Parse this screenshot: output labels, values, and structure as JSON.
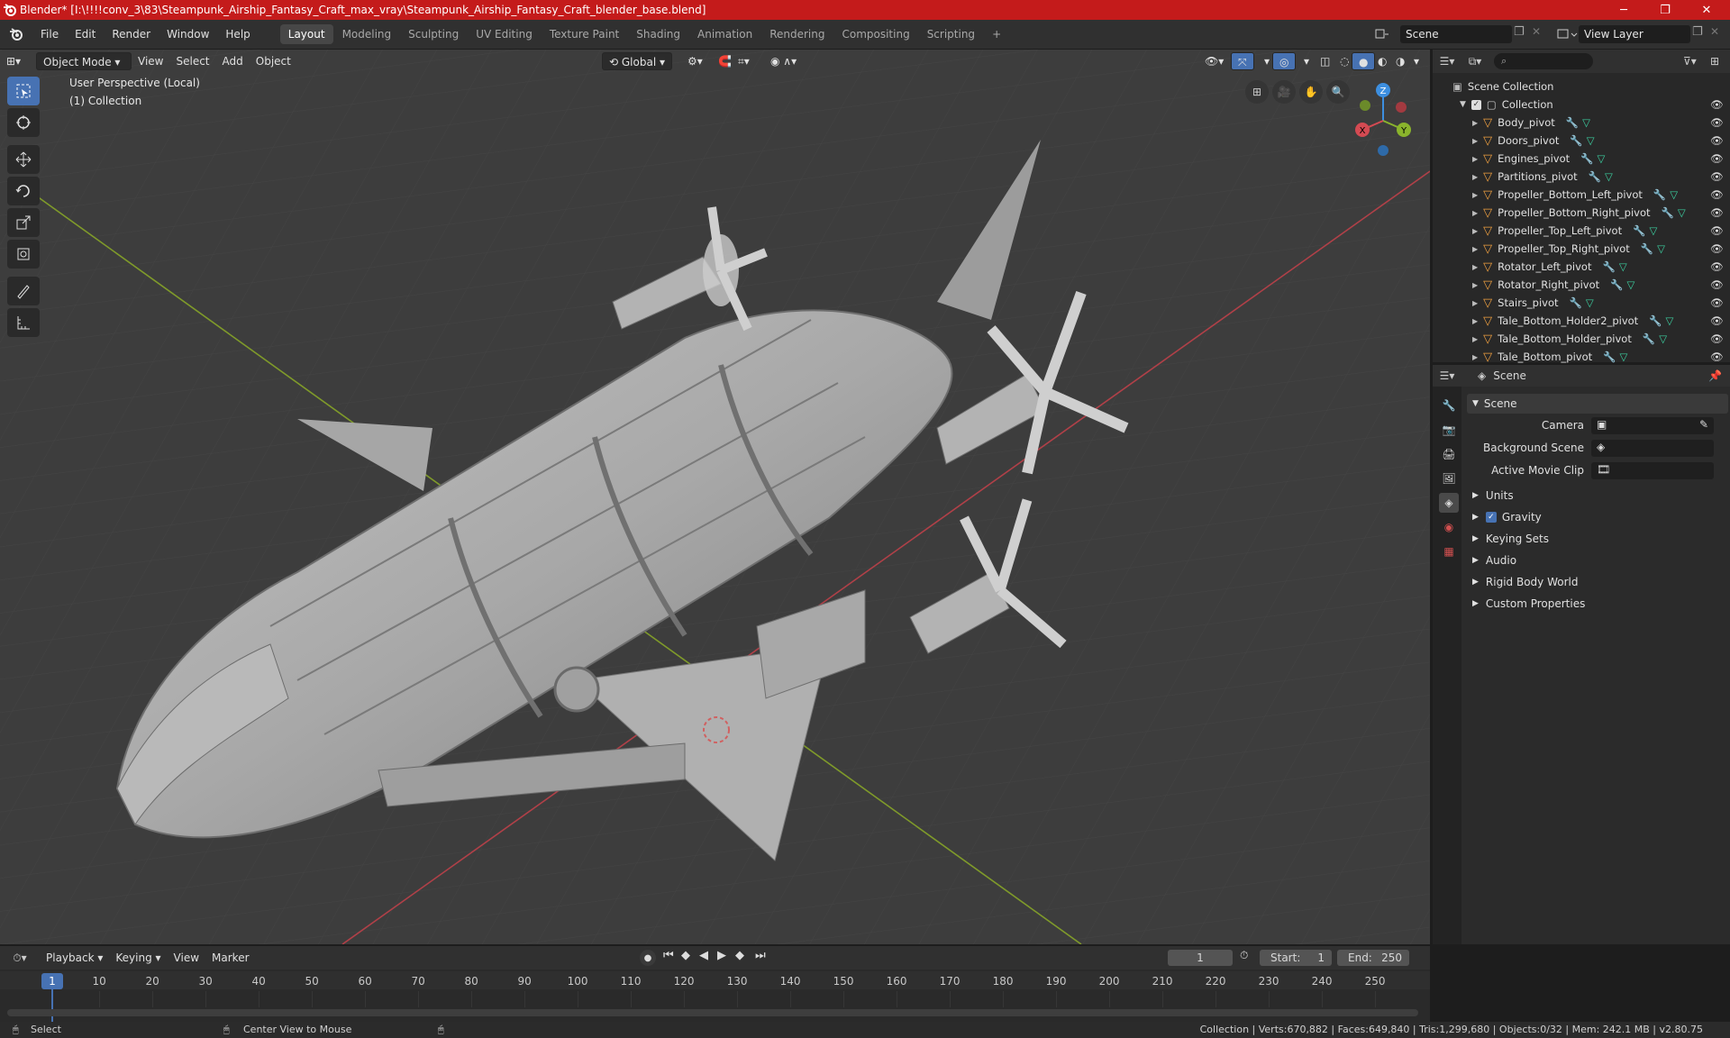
{
  "window": {
    "title": "Blender* [I:\\!!!!conv_3\\83\\Steampunk_Airship_Fantasy_Craft_max_vray\\Steampunk_Airship_Fantasy_Craft_blender_base.blend]"
  },
  "menu": {
    "file": "File",
    "edit": "Edit",
    "render": "Render",
    "window": "Window",
    "help": "Help"
  },
  "workspaces": [
    "Layout",
    "Modeling",
    "Sculpting",
    "UV Editing",
    "Texture Paint",
    "Shading",
    "Animation",
    "Rendering",
    "Compositing",
    "Scripting"
  ],
  "scene_field": "Scene",
  "view_layer_field": "View Layer",
  "viewport": {
    "mode": "Object Mode",
    "view": "View",
    "select": "Select",
    "add": "Add",
    "object": "Object",
    "orientation": "Global",
    "perspective": "User Perspective (Local)",
    "collection": "(1) Collection"
  },
  "gizmo": {
    "z": "Z",
    "y": "Y",
    "x": "X"
  },
  "outliner": {
    "root": "Scene Collection",
    "collection": "Collection",
    "items": [
      "Body_pivot",
      "Doors_pivot",
      "Engines_pivot",
      "Partitions_pivot",
      "Propeller_Bottom_Left_pivot",
      "Propeller_Bottom_Right_pivot",
      "Propeller_Top_Left_pivot",
      "Propeller_Top_Right_pivot",
      "Rotator_Left_pivot",
      "Rotator_Right_pivot",
      "Stairs_pivot",
      "Tale_Bottom_Holder2_pivot",
      "Tale_Bottom_Holder_pivot",
      "Tale_Bottom_pivot"
    ]
  },
  "properties": {
    "header": "Scene",
    "panel": "Scene",
    "camera_label": "Camera",
    "background_label": "Background Scene",
    "clip_label": "Active Movie Clip",
    "sections": [
      "Units",
      "Gravity",
      "Keying Sets",
      "Audio",
      "Rigid Body World",
      "Custom Properties"
    ]
  },
  "timeline": {
    "playback": "Playback",
    "keying": "Keying",
    "view": "View",
    "marker": "Marker",
    "current_frame": "1",
    "start_label": "Start:",
    "start": "1",
    "end_label": "End:",
    "end": "250",
    "current_marker": "1",
    "ticks": [
      "10",
      "20",
      "30",
      "40",
      "50",
      "60",
      "70",
      "80",
      "90",
      "100",
      "110",
      "120",
      "130",
      "140",
      "150",
      "160",
      "170",
      "180",
      "190",
      "200",
      "210",
      "220",
      "230",
      "240",
      "250"
    ]
  },
  "status": {
    "select": "Select",
    "center": "Center View to Mouse",
    "stats": "Collection | Verts:670,882 | Faces:649,840 | Tris:1,299,680 | Objects:0/32 | Mem: 242.1 MB | v2.80.75"
  },
  "colors": {
    "titlebar": "#c41b1b",
    "accent": "#4772b3",
    "x_axis": "#d44a52",
    "y_axis": "#8ab42c",
    "z_axis": "#3d8fe0",
    "outliner_icon": "#f0a040",
    "modifier_icon": "#5fa0e0",
    "mesh_icon": "#3ccfa0"
  }
}
